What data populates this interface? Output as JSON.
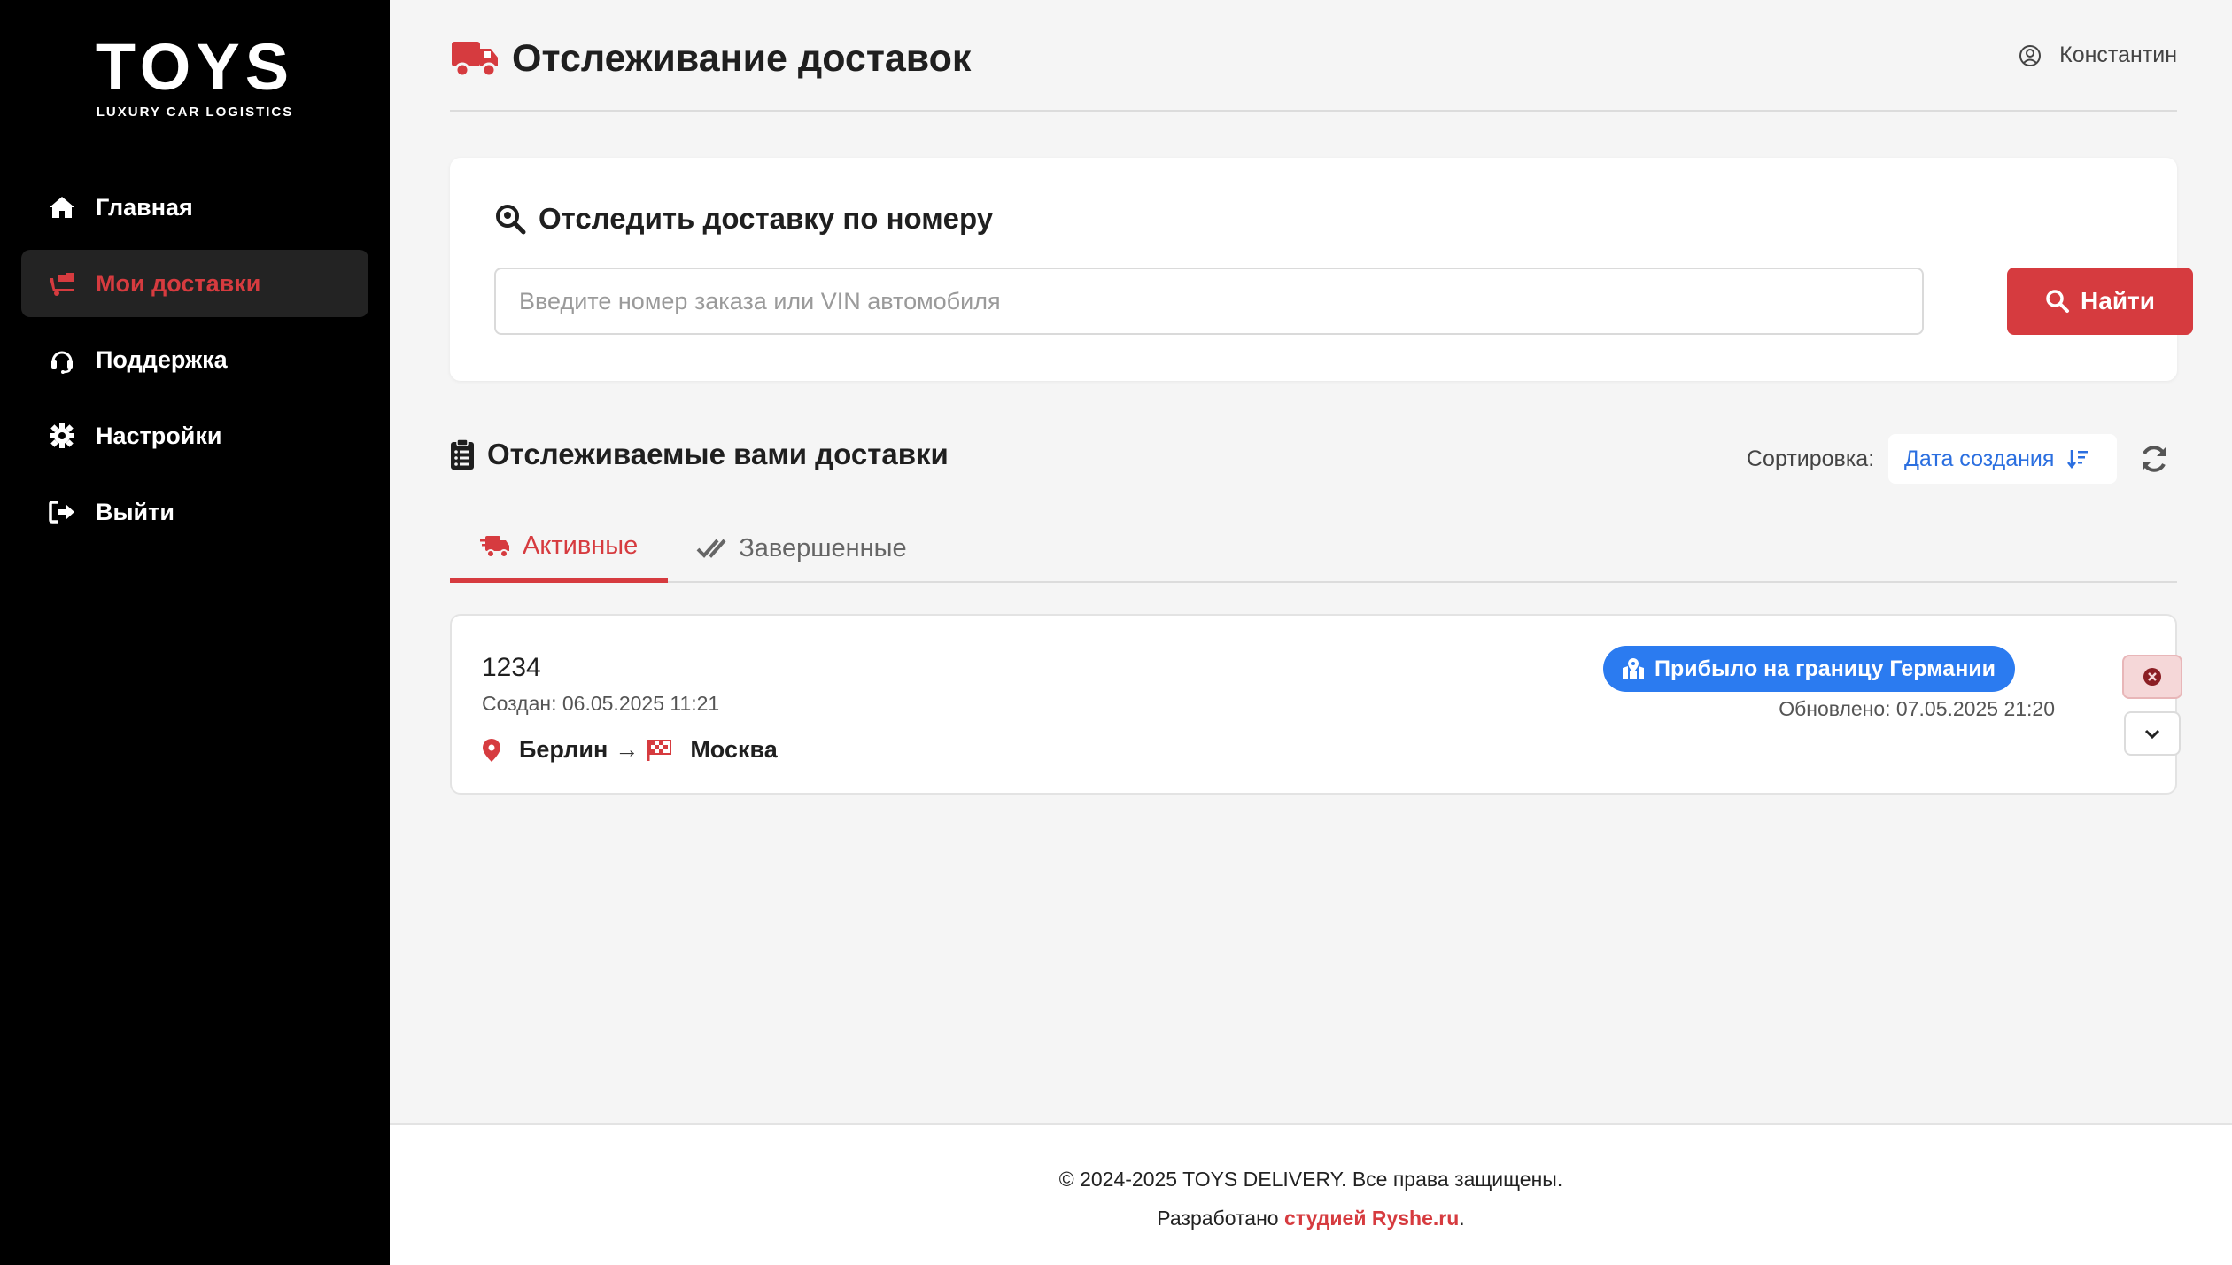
{
  "brand": {
    "logo_text": "TOYS",
    "logo_subtitle": "LUXURY CAR LOGISTICS"
  },
  "sidebar": {
    "items": [
      {
        "label": "Главная",
        "icon": "home-icon",
        "active": false
      },
      {
        "label": "Мои доставки",
        "icon": "truck-loading-icon",
        "active": true
      },
      {
        "label": "Поддержка",
        "icon": "headset-icon",
        "active": false
      },
      {
        "label": "Настройки",
        "icon": "gear-icon",
        "active": false
      },
      {
        "label": "Выйти",
        "icon": "logout-icon",
        "active": false
      }
    ]
  },
  "header": {
    "title": "Отслеживание доставок",
    "user_name": "Константин"
  },
  "search": {
    "title": "Отследить доставку по номеру",
    "placeholder": "Введите номер заказа или VIN автомобиля",
    "value": "",
    "button_label": "Найти"
  },
  "deliveries": {
    "section_title": "Отслеживаемые вами доставки",
    "sort_label": "Сортировка:",
    "sort_value": "Дата создания",
    "tabs": [
      {
        "label": "Активные",
        "active": true
      },
      {
        "label": "Завершенные",
        "active": false
      }
    ],
    "items": [
      {
        "id": "1234",
        "created": "Создан: 06.05.2025 11:21",
        "from": "Берлин",
        "arrow": "→",
        "to": "Москва",
        "status": "Прибыло на границу Германии",
        "updated": "Обновлено: 07.05.2025 21:20"
      }
    ]
  },
  "footer": {
    "copyright": "© 2024-2025 TOYS DELIVERY. Все права защищены.",
    "developed_prefix": "Разработано ",
    "developed_link": "студией Ryshe.ru",
    "developed_suffix": "."
  },
  "colors": {
    "accent": "#d63b3f",
    "status_blue": "#2b7bf0",
    "sidebar_bg": "#000000",
    "link_blue": "#2b6fe0"
  }
}
